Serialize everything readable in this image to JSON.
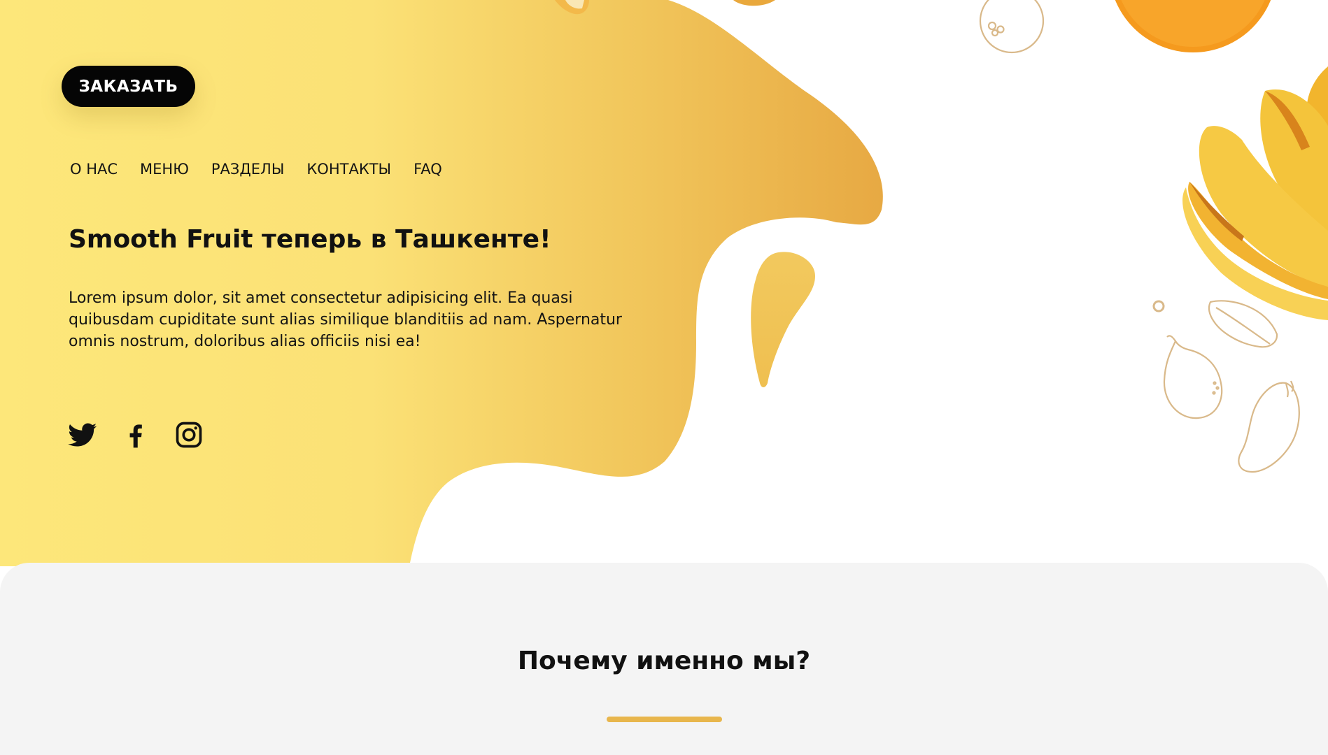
{
  "header": {
    "order_button_label": "ЗАКАЗАТЬ",
    "nav": [
      {
        "label": "О НАС"
      },
      {
        "label": "МЕНЮ"
      },
      {
        "label": "РАЗДЕЛЫ"
      },
      {
        "label": "КОНТАКТЫ"
      },
      {
        "label": "FAQ"
      }
    ]
  },
  "hero": {
    "title": "Smooth Fruit теперь в Ташкенте!",
    "text": "Lorem ipsum dolor, sit amet consectetur adipisicing elit. Ea quasi quibusdam cupiditate sunt alias similique blanditiis ad nam. Aspernatur omnis nostrum, doloribus alias officiis nisi ea!"
  },
  "social": {
    "icons": [
      "twitter-icon",
      "facebook-icon",
      "instagram-icon"
    ]
  },
  "why_section": {
    "title": "Почему именно мы?"
  },
  "colors": {
    "yellow_light": "#fde77a",
    "yellow_dark": "#e8aa46",
    "accent_underline": "#e8b64c",
    "button_bg": "#050505",
    "section_bg": "#f4f4f4"
  }
}
